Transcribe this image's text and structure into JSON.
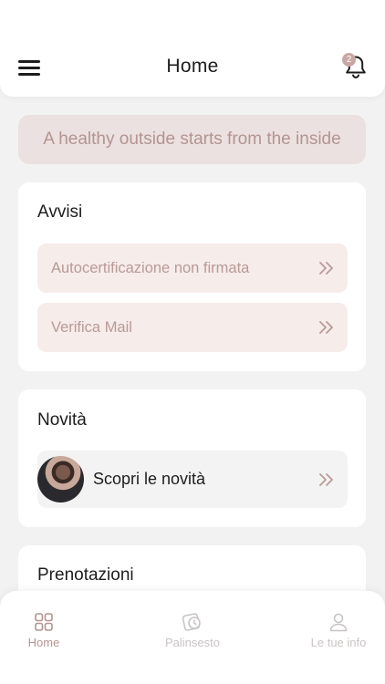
{
  "header": {
    "title": "Home",
    "notification_count": "2"
  },
  "tagline": "A healthy outside starts from the inside",
  "avvisi": {
    "title": "Avvisi",
    "items": [
      {
        "label": "Autocertificazione non firmata"
      },
      {
        "label": "Verifica Mail"
      }
    ]
  },
  "novita": {
    "title": "Novità",
    "row_label": "Scopri le novità"
  },
  "prenotazioni": {
    "title": "Prenotazioni"
  },
  "bottom_nav": {
    "items": [
      {
        "label": "Home",
        "icon": "grid-icon",
        "active": true
      },
      {
        "label": "Palinsesto",
        "icon": "schedule-icon",
        "active": false
      },
      {
        "label": "Le tue info",
        "icon": "user-icon",
        "active": false
      }
    ]
  },
  "colors": {
    "accent": "#b39490",
    "accent_light": "#ebe1e0",
    "notice_bg": "#f6ecea",
    "background": "#f3f2f3",
    "inactive": "#c9c4c4"
  }
}
